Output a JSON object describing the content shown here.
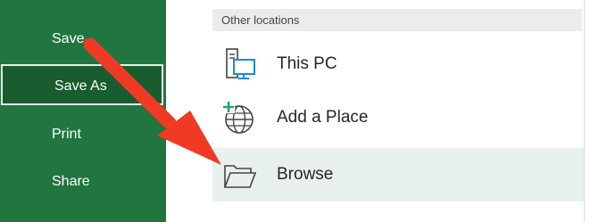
{
  "sidebar": {
    "items": [
      {
        "label": "Save"
      },
      {
        "label": "Save As"
      },
      {
        "label": "Print"
      },
      {
        "label": "Share"
      }
    ]
  },
  "main": {
    "section_header": "Other locations",
    "locations": [
      {
        "label": "This PC",
        "icon": "computer-icon"
      },
      {
        "label": "Add a Place",
        "icon": "globe-add-icon"
      },
      {
        "label": "Browse",
        "icon": "folder-open-icon"
      }
    ]
  },
  "colors": {
    "sidebar_bg": "#21763f",
    "sidebar_active": "#185c30",
    "selected_row": "#e9f1ec",
    "arrow": "#ef3b23",
    "icon_accent": "#1e88d8"
  },
  "annotation": {
    "icon": "red-arrow-pointer"
  }
}
